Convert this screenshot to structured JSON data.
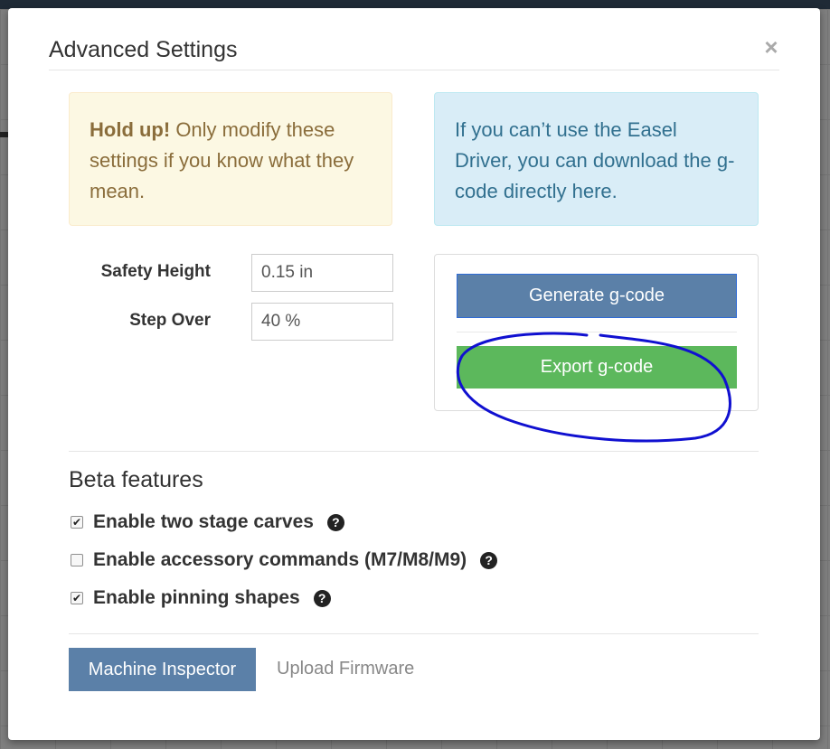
{
  "modal": {
    "title": "Advanced Settings",
    "close_label": "×"
  },
  "alerts": {
    "warning_strong": "Hold up!",
    "warning_text": " Only modify these settings if you know what they mean.",
    "info_text": "If you can’t use the Easel Driver, you can download the g-code directly here."
  },
  "settings": {
    "safety_height_label": "Safety Height",
    "safety_height_value": "0.15 in",
    "step_over_label": "Step Over",
    "step_over_value": "40 %"
  },
  "export": {
    "generate_label": "Generate g-code",
    "export_label": "Export g-code"
  },
  "beta": {
    "heading": "Beta features",
    "features": [
      {
        "label": "Enable two stage carves",
        "checked": true,
        "icon": "question-circle-icon"
      },
      {
        "label": "Enable accessory commands (M7/M8/M9)",
        "checked": false,
        "icon": "question-circle-icon"
      },
      {
        "label": "Enable pinning shapes",
        "checked": true,
        "icon": "question-circle-icon"
      }
    ]
  },
  "footer": {
    "machine_inspector_label": "Machine Inspector",
    "upload_firmware_label": "Upload Firmware"
  },
  "colors": {
    "primary": "#5b80a8",
    "success": "#5cb85c",
    "annotation": "#1010d0"
  }
}
